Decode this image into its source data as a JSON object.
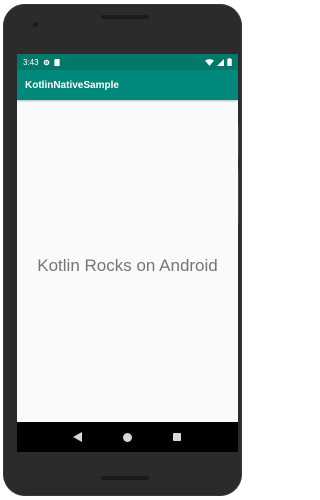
{
  "status_bar": {
    "time": "3:43",
    "icons": [
      "gear-icon",
      "sd-card-icon",
      "wifi-icon",
      "signal-icon",
      "battery-icon"
    ]
  },
  "app_bar": {
    "title": "KotlinNativeSample"
  },
  "main": {
    "text": "Kotlin Rocks on Android"
  },
  "nav_bar": {
    "buttons": [
      "back-icon",
      "home-icon",
      "recents-icon"
    ]
  },
  "colors": {
    "status_bar": "#00796b",
    "app_bar": "#00897b",
    "body_text": "#757575",
    "device_frame": "#2b2b2d"
  }
}
